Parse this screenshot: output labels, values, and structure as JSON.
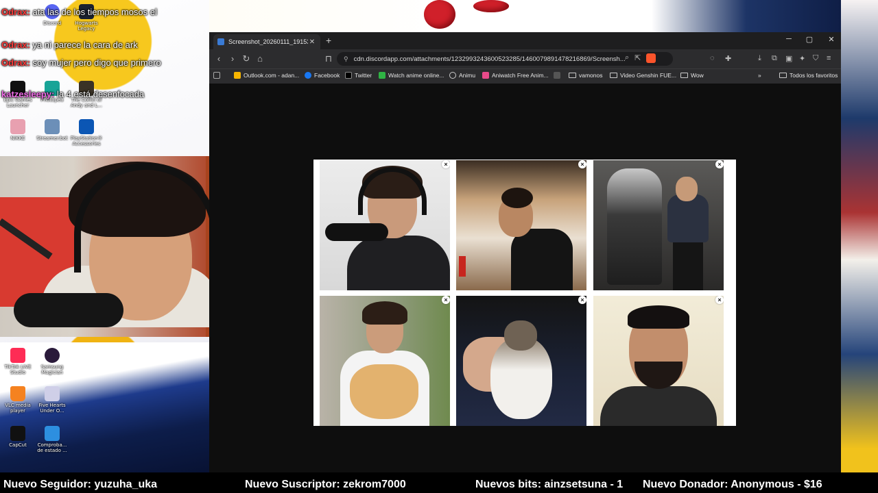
{
  "chat": [
    {
      "user": "Odrax:",
      "message": "ata las de los tiempos mosos el"
    },
    {
      "user": "Odrax:",
      "message": "ya ni parece la cara de ark"
    },
    {
      "user": "Odrax:",
      "message": "soy mujer pero digo que primero"
    },
    {
      "user": "katzesleepy:",
      "message": "la 4 está desenfocada"
    }
  ],
  "desktop_icons": [
    {
      "label": "Discord"
    },
    {
      "label": "Hogwarts Legacy"
    },
    {
      "label": "Photopea"
    },
    {
      "label": "The Coffin of Andy and L..."
    },
    {
      "label": "Epic Games Launcher"
    },
    {
      "label": "NIKKE"
    },
    {
      "label": "Streamer.bot"
    },
    {
      "label": "PlayStation® Accessories"
    },
    {
      "label": "TikTok LIVE Studio"
    },
    {
      "label": "Samsung Magician"
    },
    {
      "label": "VLC media player"
    },
    {
      "label": "Five Hearts Under O..."
    },
    {
      "label": "CapCut"
    },
    {
      "label": "Comproba... de estado ..."
    }
  ],
  "browser": {
    "tab_title": "Screenshot_20260111_191535_I",
    "url": "cdn.discordapp.com/attachments/1232993243600523285/1460079891478216869/Screensh...",
    "bookmarks": [
      {
        "label": "Outlook.com - adan...",
        "icon": "outlook-icon"
      },
      {
        "label": "Facebook",
        "icon": "facebook-icon"
      },
      {
        "label": "Twitter",
        "icon": "x-icon"
      },
      {
        "label": "Watch anime online...",
        "icon": "anime-icon"
      },
      {
        "label": "Animu",
        "icon": "globe-icon"
      },
      {
        "label": "Aniwatch Free Anim...",
        "icon": "aniwatch-icon"
      },
      {
        "label": "",
        "icon": "y-icon"
      },
      {
        "label": "vamonos",
        "icon": "folder-icon"
      },
      {
        "label": "Video Genshin FUE...",
        "icon": "folder-icon"
      },
      {
        "label": "Wow",
        "icon": "folder-icon"
      }
    ],
    "all_bookmarks": "Todos los favoritos",
    "remove_symbol": "×"
  },
  "ticker": {
    "follower": "Nuevo Seguidor: yuzuha_uka",
    "subscriber": "Nuevo Suscriptor: zekrom7000",
    "bits": "Nuevos bits: ainzsetsuna - 1",
    "donor": "Nuevo Donador: Anonymous - $16"
  }
}
